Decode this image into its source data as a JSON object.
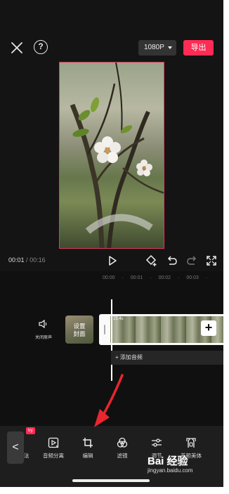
{
  "topbar": {
    "close_icon": "close-icon",
    "help_label": "?",
    "resolution": "1080P",
    "export_label": "导出",
    "accent_color": "#fe2c55"
  },
  "playback": {
    "current_time": "00:01",
    "separator": "/",
    "total_time": "00:16",
    "icons": [
      "play-icon",
      "keyframe-icon",
      "undo-icon",
      "redo-icon",
      "fullscreen-icon"
    ]
  },
  "timeline": {
    "ruler": [
      "00:00",
      "·",
      "00:01",
      "·",
      "00:02",
      "·",
      "00:03",
      "·"
    ],
    "mute_label": "关闭原声",
    "cover_label": "设置\n封面",
    "clip_duration": "15.4s",
    "add_clip_label": "+",
    "add_audio_label": "+ 添加音频"
  },
  "toolbar": {
    "back_label": "<",
    "try_badge": "try",
    "partial_label": "法",
    "items": [
      {
        "label": "音频分离",
        "icon": "audio-separate-icon"
      },
      {
        "label": "编辑",
        "icon": "crop-icon"
      },
      {
        "label": "滤镜",
        "icon": "filter-icon"
      },
      {
        "label": "调节",
        "icon": "adjust-icon"
      },
      {
        "label": "美颜美体",
        "icon": "beauty-icon"
      }
    ]
  },
  "watermark": {
    "brand": "Bai 经验",
    "url": "jingyan.baidu.com"
  }
}
